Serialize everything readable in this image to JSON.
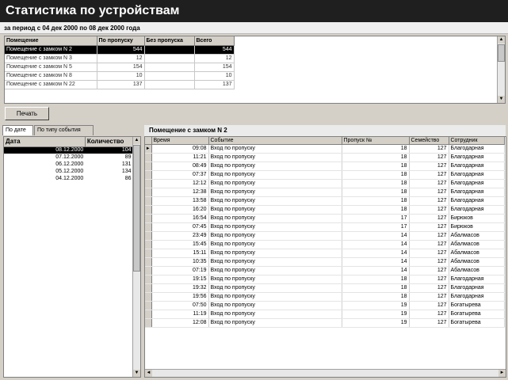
{
  "header": {
    "title": "Статистика по устройствам"
  },
  "period": "за период с 04 дек 2000 по 08 дек 2000 года",
  "rooms": {
    "columns": [
      "Помещение",
      "По пропуску",
      "Без пропуска",
      "Всего"
    ],
    "rows": [
      {
        "name": "Помещение с замком N 2",
        "by_pass": "544",
        "without_pass": "",
        "total": "544"
      },
      {
        "name": "Помещение с замком N 3",
        "by_pass": "12",
        "without_pass": "",
        "total": "12"
      },
      {
        "name": "Помещение с замком N 5",
        "by_pass": "154",
        "without_pass": "",
        "total": "154"
      },
      {
        "name": "Помещение с замком N 8",
        "by_pass": "10",
        "without_pass": "",
        "total": "10"
      },
      {
        "name": "Помещение с замком N 22",
        "by_pass": "137",
        "without_pass": "",
        "total": "137"
      }
    ],
    "selected_index": 0
  },
  "print_button": "Печать",
  "tabs": [
    "По дате",
    "По типу события"
  ],
  "dates": {
    "columns": [
      "Дата",
      "Количество"
    ],
    "rows": [
      {
        "date": "08.12.2000",
        "count": "104"
      },
      {
        "date": "07.12.2000",
        "count": "89"
      },
      {
        "date": "06.12.2000",
        "count": "131"
      },
      {
        "date": "05.12.2000",
        "count": "134"
      },
      {
        "date": "04.12.2000",
        "count": "86"
      }
    ],
    "selected_index": 0
  },
  "detail": {
    "title": "Помещение с замком N 2",
    "columns": [
      "Время",
      "Событие",
      "Пропуск №",
      "Семейство",
      "Сотрудник"
    ],
    "rows": [
      {
        "time": "09:08",
        "event": "Вход по пропуску",
        "pass": "18",
        "family": "127",
        "employee": "Благодарная"
      },
      {
        "time": "11:21",
        "event": "Вход по пропуску",
        "pass": "18",
        "family": "127",
        "employee": "Благодарная"
      },
      {
        "time": "08:49",
        "event": "Вход по пропуску",
        "pass": "18",
        "family": "127",
        "employee": "Благодарная"
      },
      {
        "time": "07:37",
        "event": "Вход по пропуску",
        "pass": "18",
        "family": "127",
        "employee": "Благодарная"
      },
      {
        "time": "12:12",
        "event": "Вход по пропуску",
        "pass": "18",
        "family": "127",
        "employee": "Благодарная"
      },
      {
        "time": "12:38",
        "event": "Вход по пропуску",
        "pass": "18",
        "family": "127",
        "employee": "Благодарная"
      },
      {
        "time": "13:58",
        "event": "Вход по пропуску",
        "pass": "18",
        "family": "127",
        "employee": "Благодарная"
      },
      {
        "time": "16:20",
        "event": "Вход по пропуску",
        "pass": "18",
        "family": "127",
        "employee": "Благодарная"
      },
      {
        "time": "16:54",
        "event": "Вход по пропуску",
        "pass": "17",
        "family": "127",
        "employee": "Бирюков"
      },
      {
        "time": "07:45",
        "event": "Вход по пропуску",
        "pass": "17",
        "family": "127",
        "employee": "Бирюков"
      },
      {
        "time": "23:49",
        "event": "Вход по пропуску",
        "pass": "14",
        "family": "127",
        "employee": "Абалмасов"
      },
      {
        "time": "15:45",
        "event": "Вход по пропуску",
        "pass": "14",
        "family": "127",
        "employee": "Абалмасов"
      },
      {
        "time": "15:11",
        "event": "Вход по пропуску",
        "pass": "14",
        "family": "127",
        "employee": "Абалмасов"
      },
      {
        "time": "10:35",
        "event": "Вход по пропуску",
        "pass": "14",
        "family": "127",
        "employee": "Абалмасов"
      },
      {
        "time": "07:19",
        "event": "Вход по пропуску",
        "pass": "14",
        "family": "127",
        "employee": "Абалмасов"
      },
      {
        "time": "19:15",
        "event": "Вход по пропуску",
        "pass": "18",
        "family": "127",
        "employee": "Благодарная"
      },
      {
        "time": "19:32",
        "event": "Вход по пропуску",
        "pass": "18",
        "family": "127",
        "employee": "Благодарная"
      },
      {
        "time": "19:56",
        "event": "Вход по пропуску",
        "pass": "18",
        "family": "127",
        "employee": "Благодарная"
      },
      {
        "time": "07:50",
        "event": "Вход по пропуску",
        "pass": "19",
        "family": "127",
        "employee": "Богатырева"
      },
      {
        "time": "11:19",
        "event": "Вход по пропуску",
        "pass": "19",
        "family": "127",
        "employee": "Богатырева"
      },
      {
        "time": "12:08",
        "event": "Вход по пропуску",
        "pass": "19",
        "family": "127",
        "employee": "Богатырева"
      }
    ],
    "current_row_index": 0
  },
  "colors": {
    "selected_bg": "#000000",
    "title_bg": "#1f1f1f",
    "window_bg": "#d4d0c8"
  }
}
